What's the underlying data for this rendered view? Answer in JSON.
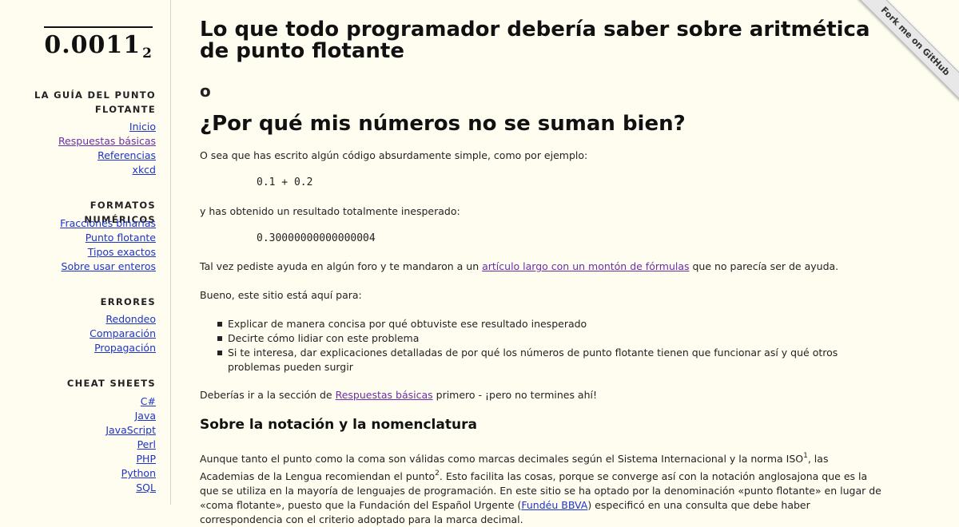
{
  "logo": {
    "main": "0.0011",
    "sub": "2"
  },
  "sidebar": {
    "sections": [
      {
        "title": "LA GUÍA DEL PUNTO FLOTANTE",
        "links": [
          "Inicio",
          "Respuestas básicas",
          "Referencias",
          "xkcd"
        ]
      },
      {
        "title": "FORMATOS NUMÉRICOS",
        "links": [
          "Fracciones binarias",
          "Punto flotante",
          "Tipos exactos",
          "Sobre usar enteros"
        ]
      },
      {
        "title": "ERRORES",
        "links": [
          "Redondeo",
          "Comparación",
          "Propagación"
        ]
      },
      {
        "title": "CHEAT SHEETS",
        "links": [
          "C#",
          "Java",
          "JavaScript",
          "Perl",
          "PHP",
          "Python",
          "SQL"
        ]
      }
    ]
  },
  "ribbon": {
    "label": "Fork me on GitHub"
  },
  "main": {
    "title": "Lo que todo programador debería saber sobre aritmética de punto flotante",
    "or": "o",
    "subtitle": "¿Por qué mis números no se suman bien?",
    "p1": "O sea que has escrito algún código absurdamente simple, como por ejemplo:",
    "code1": "0.1 + 0.2",
    "p2": "y has obtenido un resultado totalmente inesperado:",
    "code2": "0.30000000000000004",
    "p3_before": "Tal vez pediste ayuda en algún foro y te mandaron a un ",
    "p3_link": "artículo largo con un montón de fórmulas",
    "p3_after": " que no parecía ser de ayuda.",
    "p4": "Bueno, este sitio está aquí para:",
    "bullets": [
      "Explicar de manera concisa por qué obtuviste ese resultado inesperado",
      "Decirte cómo lidiar con este problema",
      "Si te interesa, dar explicaciones detalladas de por qué los números de punto flotante tienen que funcionar así y qué otros problemas pueden surgir"
    ],
    "p5_before": "Deberías ir a la sección de ",
    "p5_link": "Respuestas básicas",
    "p5_after": " primero - ¡pero no termines ahí!",
    "h3": "Sobre la notación y la nomenclatura",
    "p6_a": "Aunque tanto el punto como la coma son válidas como marcas decimales según el Sistema Internacional y la norma ISO",
    "p6_sup1": "1",
    "p6_b": ", las Academias de la Lengua recomiendan el punto",
    "p6_sup2": "2",
    "p6_c": ". Esto facilita las cosas, porque se converge así con la notación anglosajona que es la que se utiliza en la mayoría de lenguajes de programación. En este sitio se ha optado por la denominación «punto flotante» en lugar de «coma flotante», puesto que la Fundación del Español Urgente (",
    "p6_link": "Fundéu BBVA",
    "p6_d": ") especificó en una consulta que debe haber correspondencia con el criterio adoptado para la marca decimal."
  }
}
